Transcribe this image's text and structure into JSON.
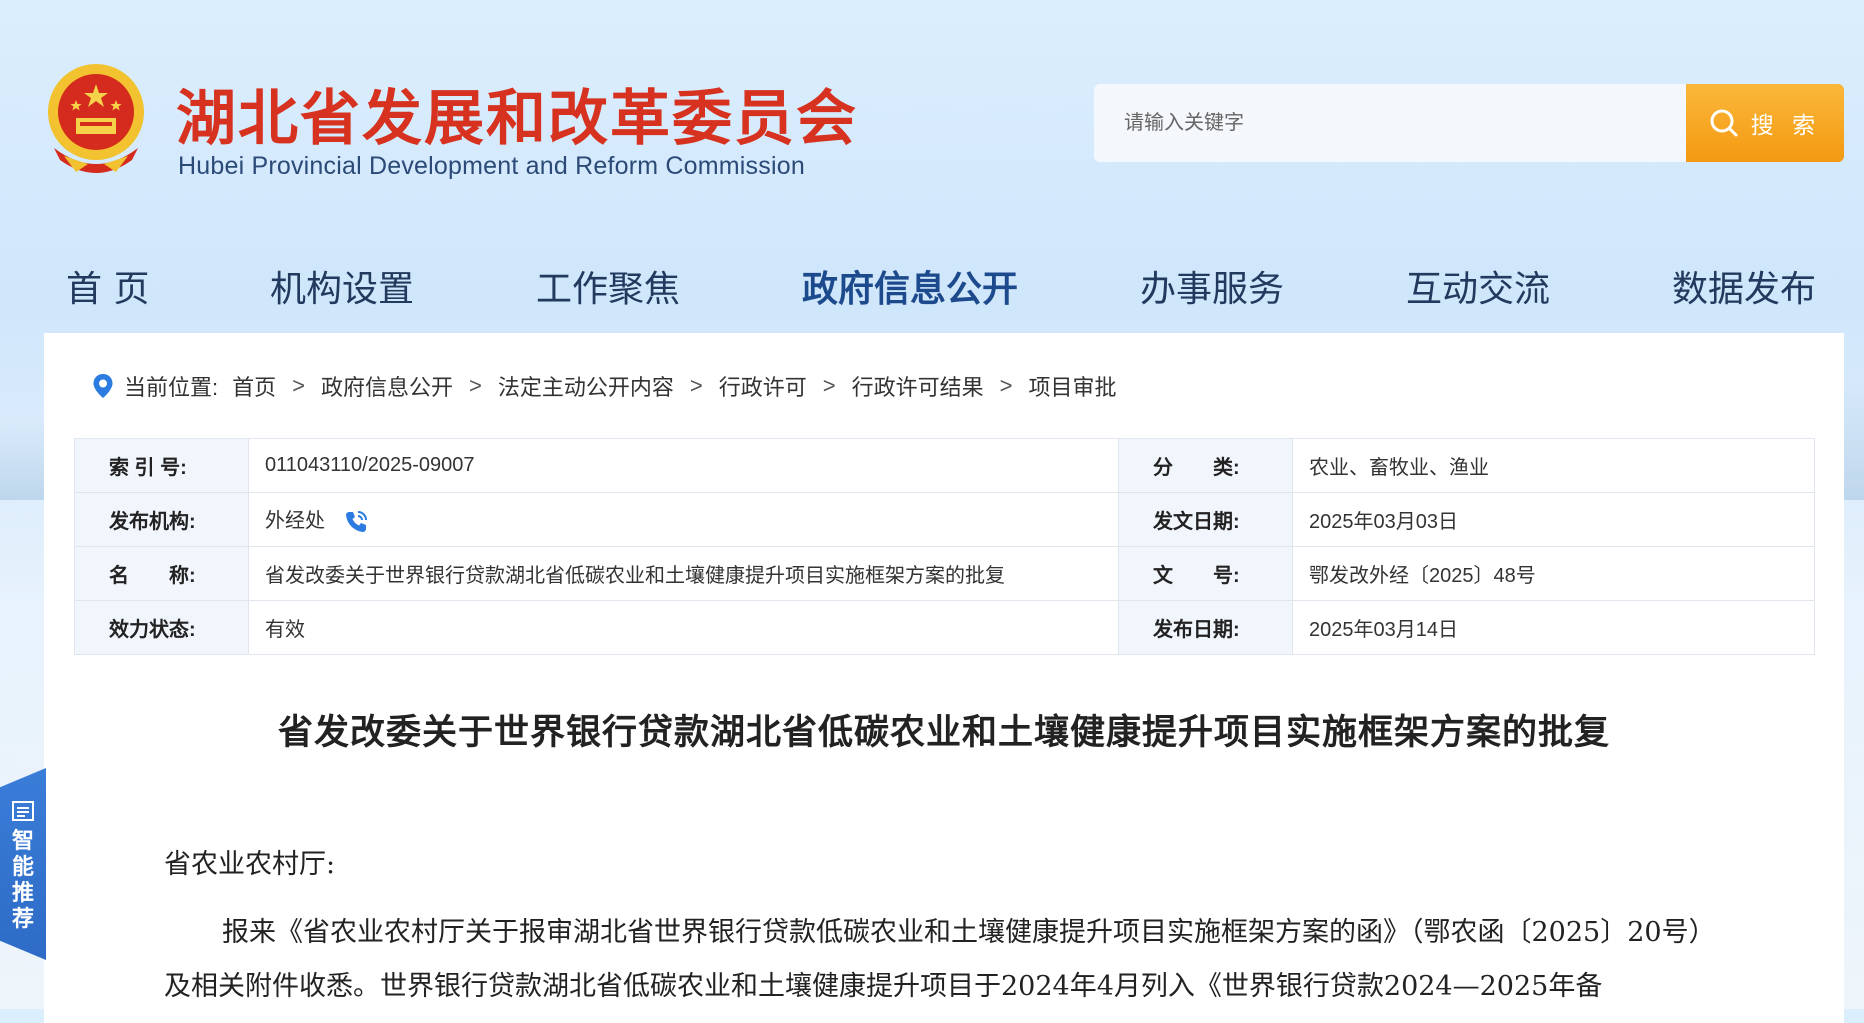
{
  "header": {
    "title": "湖北省发展和改革委员会",
    "subtitle": "Hubei Provincial Development and Reform Commission",
    "search_placeholder": "请输入关键字",
    "search_button": "搜 索"
  },
  "nav": [
    {
      "label": "首 页"
    },
    {
      "label": "机构设置"
    },
    {
      "label": "工作聚焦"
    },
    {
      "label": "政府信息公开"
    },
    {
      "label": "办事服务"
    },
    {
      "label": "互动交流"
    },
    {
      "label": "数据发布"
    }
  ],
  "breadcrumb": {
    "prefix": "当前位置:",
    "items": [
      "首页",
      "政府信息公开",
      "法定主动公开内容",
      "行政许可",
      "行政许可结果",
      "项目审批"
    ],
    "separator": ">"
  },
  "meta": {
    "index_label": "索 引 号:",
    "index_value": "011043110/2025-09007",
    "category_label": "分　　类:",
    "category_value": "农业、畜牧业、渔业",
    "org_label": "发布机构:",
    "org_value": "外经处",
    "doc_date_label": "发文日期:",
    "doc_date_value": "2025年03月03日",
    "name_label": "名　　称:",
    "name_value": "省发改委关于世界银行贷款湖北省低碳农业和土壤健康提升项目实施框架方案的批复",
    "doc_no_label": "文　　号:",
    "doc_no_value": "鄂发改外经〔2025〕48号",
    "status_label": "效力状态:",
    "status_value": "有效",
    "pub_date_label": "发布日期:",
    "pub_date_value": "2025年03月14日"
  },
  "article": {
    "title": "省发改委关于世界银行贷款湖北省低碳农业和土壤健康提升项目实施框架方案的批复",
    "salutation": "省农业农村厅:",
    "paragraph1": "报来《省农业农村厅关于报审湖北省世界银行贷款低碳农业和土壤健康提升项目实施框架方案的函》（鄂农函〔2025〕20号）及相关附件收悉。世界银行贷款湖北省低碳农业和土壤健康提升项目于2024年4月列入《世界银行贷款2024—2025年备"
  },
  "side_tab": {
    "label": "智能推荐"
  },
  "colors": {
    "title_red": "#d6321f",
    "search_orange": "#f5a623",
    "nav_blue": "#1c4a8c",
    "side_tab_blue": "#2d6bc6"
  }
}
